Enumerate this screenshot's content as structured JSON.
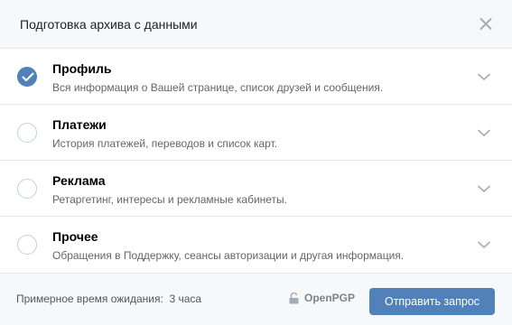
{
  "header": {
    "title": "Подготовка архива с данными"
  },
  "items": [
    {
      "title": "Профиль",
      "description": "Вся информация о Вашей странице, список друзей и сообщения.",
      "checked": true
    },
    {
      "title": "Платежи",
      "description": "История платежей, переводов и список карт.",
      "checked": false
    },
    {
      "title": "Реклама",
      "description": "Ретаргетинг, интересы и рекламные кабинеты.",
      "checked": false
    },
    {
      "title": "Прочее",
      "description": "Обращения в Поддержку, сеансы авторизации и другая информация.",
      "checked": false
    }
  ],
  "footer": {
    "wait_text": "Примерное время ожидания:  3 часа",
    "pgp_label": "OpenPGP",
    "submit_label": "Отправить запрос"
  },
  "colors": {
    "accent": "#5181b8",
    "header_bg": "#f7f8fa",
    "divider": "#e7e8ec"
  },
  "icons": {
    "close": "close-icon",
    "chevron": "chevron-down-icon",
    "lock": "unlock-icon",
    "check": "checkmark-icon"
  }
}
